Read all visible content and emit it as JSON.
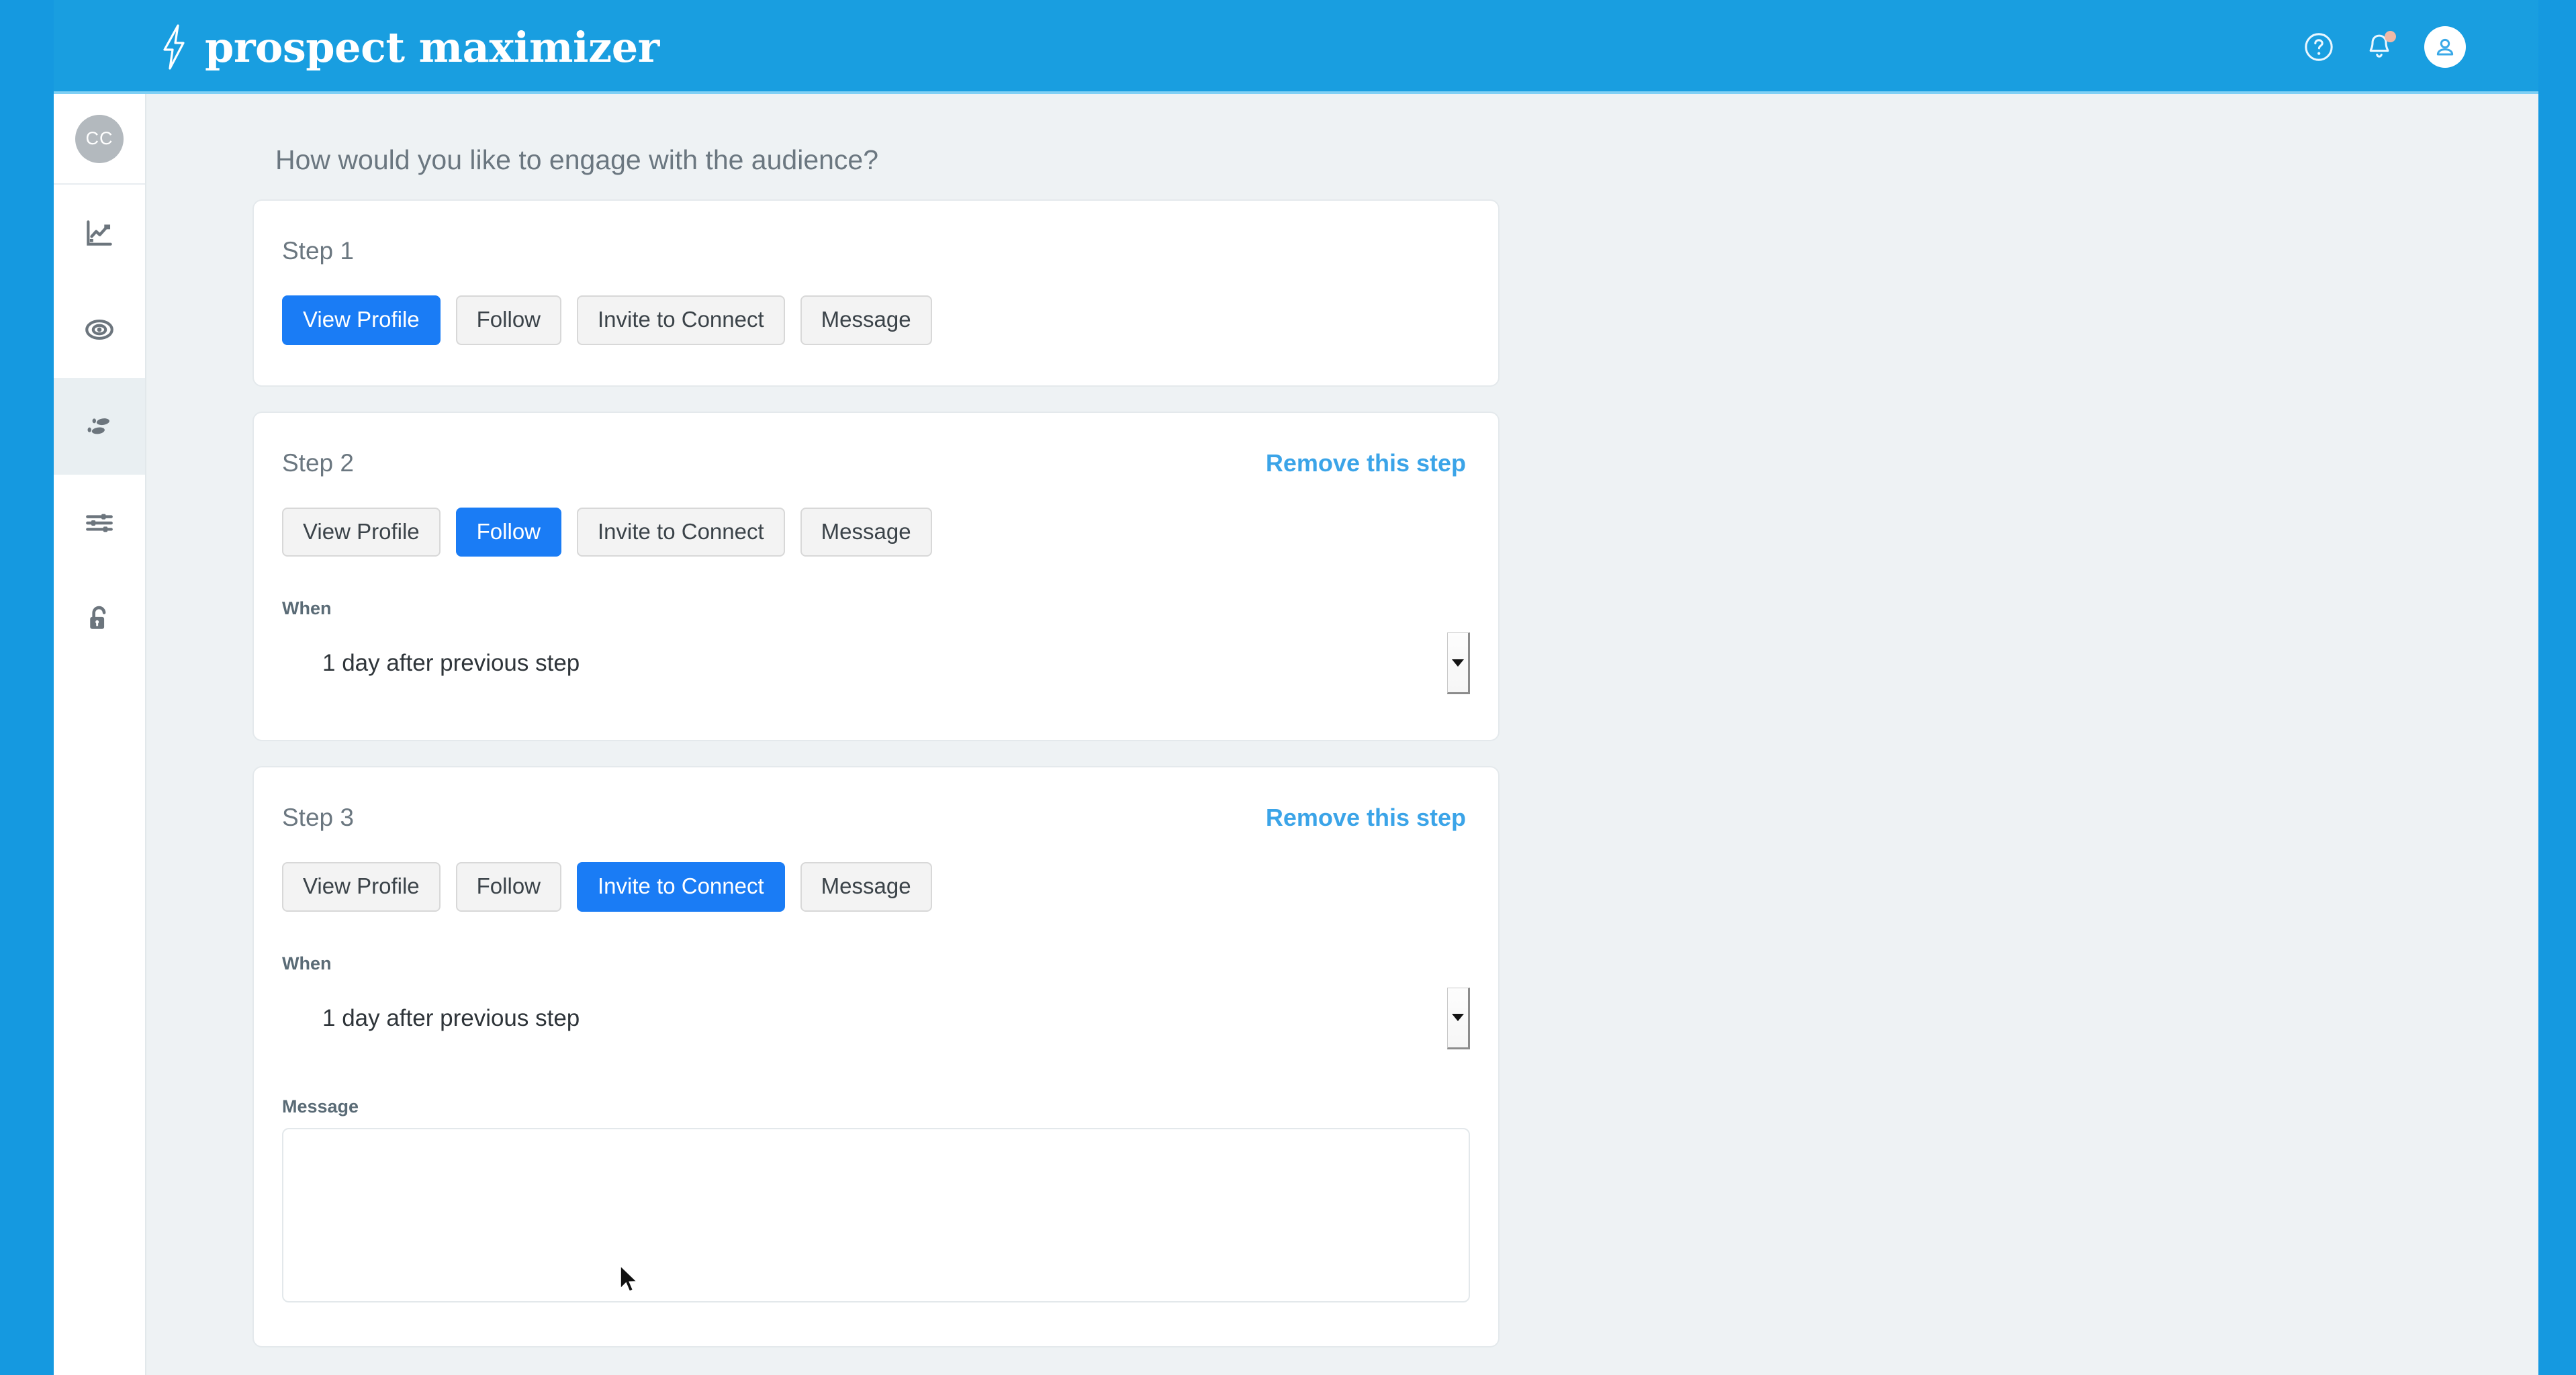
{
  "header": {
    "logo_text": "prospect maximizer",
    "bolt_icon": "lightning-bolt-icon",
    "help_icon": "help-circle-icon",
    "notifications_icon": "bell-icon",
    "avatar_icon": "user-avatar-icon",
    "brand_color": "#199ee0"
  },
  "sidebar": {
    "avatar_initials": "CC",
    "items": [
      {
        "icon": "analytics-chart-icon",
        "active": false
      },
      {
        "icon": "target-eye-icon",
        "active": false
      },
      {
        "icon": "footsteps-icon",
        "active": true
      },
      {
        "icon": "sliders-filter-icon",
        "active": false
      },
      {
        "icon": "unlock-padlock-icon",
        "active": false
      }
    ]
  },
  "main": {
    "question": "How would you like to engage with the audience?",
    "action_options": [
      "View Profile",
      "Follow",
      "Invite to Connect",
      "Message"
    ],
    "remove_label": "Remove this step",
    "when_label": "When",
    "message_label": "Message",
    "steps": [
      {
        "title": "Step 1",
        "selected_action": "View Profile",
        "has_remove": false,
        "has_when": false,
        "has_message": false,
        "when_value": "",
        "message_value": ""
      },
      {
        "title": "Step 2",
        "selected_action": "Follow",
        "has_remove": true,
        "has_when": true,
        "has_message": false,
        "when_value": "1 day after previous step",
        "message_value": ""
      },
      {
        "title": "Step 3",
        "selected_action": "Invite to Connect",
        "has_remove": true,
        "has_when": true,
        "has_message": true,
        "when_value": "1 day after previous step",
        "message_value": ""
      }
    ]
  },
  "colors": {
    "accent_blue": "#199ee0",
    "selected_button": "#1a7cf5",
    "link_blue": "#3ba4e8",
    "page_bg": "#eef2f4"
  }
}
